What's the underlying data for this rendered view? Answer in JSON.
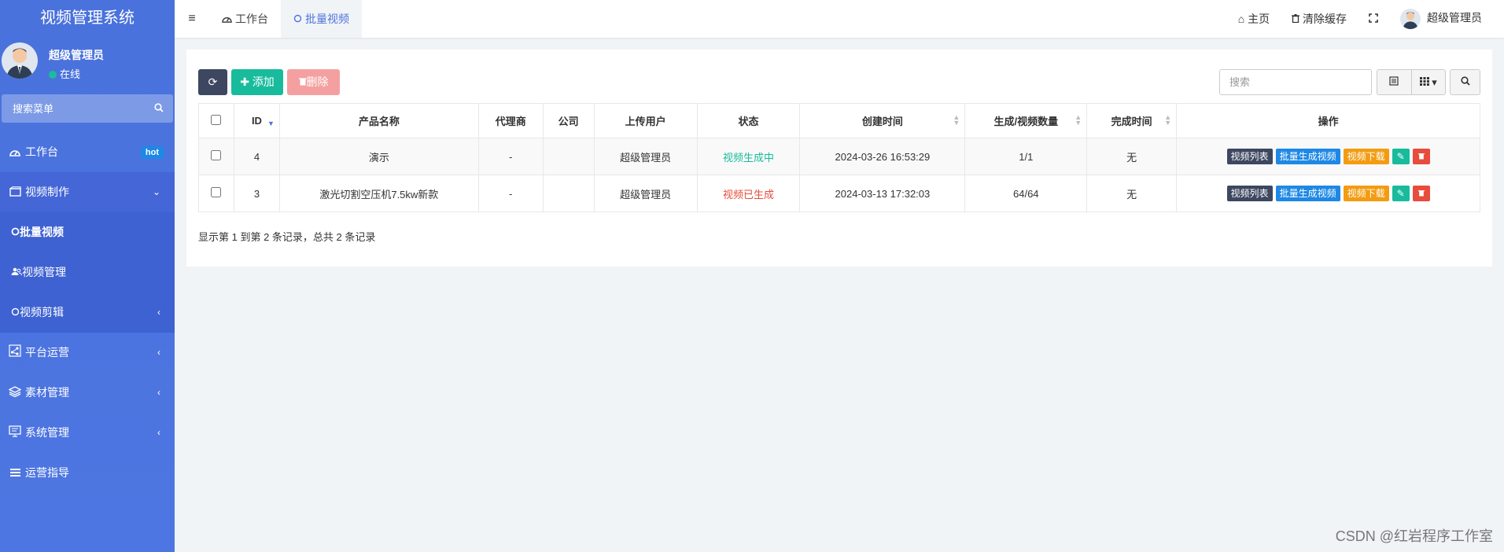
{
  "app": {
    "title": "视频管理系统"
  },
  "user": {
    "name": "超级管理员",
    "status": "在线"
  },
  "sidebar_search": {
    "placeholder": "搜索菜单"
  },
  "menu": {
    "workbench": {
      "label": "工作台",
      "badge": "hot"
    },
    "video_make": {
      "label": "视频制作"
    },
    "sub": {
      "batch": "批量视频",
      "manage": "视频管理",
      "edit": "视频剪辑"
    },
    "platform": {
      "label": "平台运营"
    },
    "material": {
      "label": "素材管理"
    },
    "system": {
      "label": "系统管理"
    },
    "guide": {
      "label": "运营指导"
    }
  },
  "tabs": [
    {
      "label": "工作台"
    },
    {
      "label": "批量视频"
    }
  ],
  "topbar": {
    "home": "主页",
    "clear_cache": "清除缓存",
    "user": "超级管理员"
  },
  "toolbar": {
    "add": "添加",
    "delete": "删除",
    "search_placeholder": "搜索"
  },
  "table": {
    "headers": [
      "ID",
      "产品名称",
      "代理商",
      "公司",
      "上传用户",
      "状态",
      "创建时间",
      "生成/视频数量",
      "完成时间",
      "操作"
    ],
    "rows": [
      {
        "id": "4",
        "name": "演示",
        "agent": "-",
        "company": "",
        "uploader": "超级管理员",
        "status": "视频生成中",
        "created": "2024-03-26 16:53:29",
        "count": "1/1",
        "finished": "无"
      },
      {
        "id": "3",
        "name": "激光切割空压机7.5kw新款",
        "agent": "-",
        "company": "",
        "uploader": "超级管理员",
        "status": "视频已生成",
        "created": "2024-03-13 17:32:03",
        "count": "64/64",
        "finished": "无"
      }
    ],
    "ops": {
      "list": "视频列表",
      "batch": "批量生成视频",
      "download": "视频下载"
    }
  },
  "summary": "显示第 1 到第 2 条记录，总共 2 条记录",
  "watermark": "CSDN @红岩程序工作室",
  "colors": {
    "sidebar": "#4e73df",
    "accent": "#18bc9c",
    "status_running": "#18bc9c",
    "status_done": "#e74c3c"
  }
}
